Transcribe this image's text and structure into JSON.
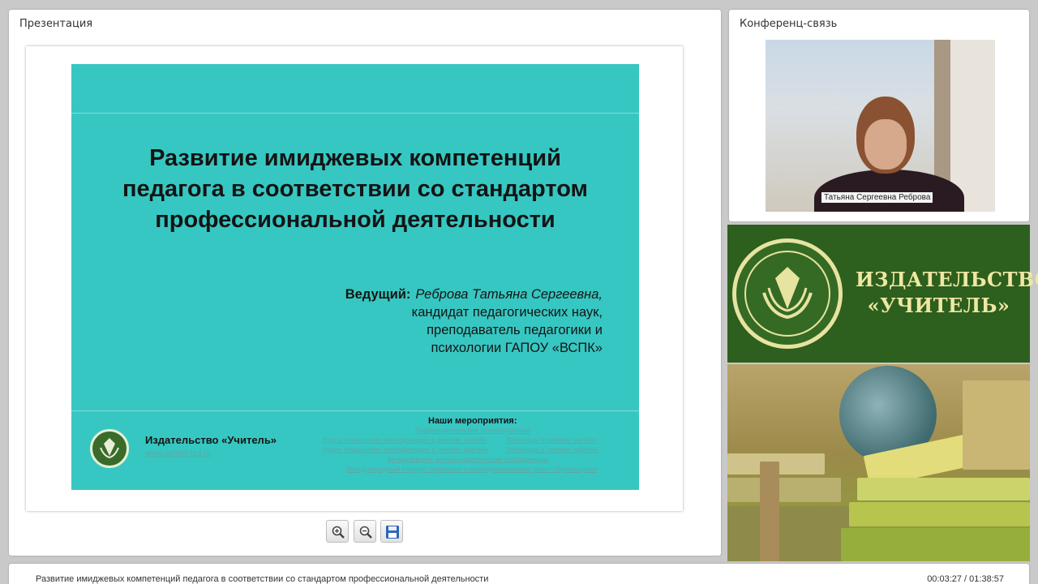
{
  "presentation": {
    "panel_title": "Презентация",
    "slide": {
      "title_lines": [
        "Развитие имиджевых компетенций",
        "педагога в соответствии со стандартом",
        "профессиональной деятельности"
      ],
      "presenter_label": "Ведущий:",
      "presenter_name": "Реброва Татьяна Сергеевна,",
      "presenter_details": [
        "кандидат педагогических наук,",
        "преподаватель педагогики и",
        "психологии ГАПОУ «ВСПК»"
      ],
      "publisher_name": "Издательство «Учитель»",
      "publisher_url": "www.uchitel-izd.ru",
      "events_title": "Наши мероприятия:",
      "events": [
        "Профессиональная переподготовка",
        "Курсы повышения квалификации в режиме онлайн",
        "Вебинары в режиме онлайн",
        "Курсы повышения квалификации в режиме офлайн",
        "Вебинары в режиме офлайн",
        "Межвузовские научно-практические конференции",
        "Международный конкурс проектных и исследовательских работ обучающихся"
      ]
    },
    "toolbar": {
      "zoom_in_icon": "zoom-in-icon",
      "zoom_out_icon": "zoom-out-icon",
      "save_icon": "save-icon"
    }
  },
  "conference": {
    "panel_title": "Конференц-связь",
    "participant_name": "Татьяна Сергеевна Реброва"
  },
  "brand": {
    "line1": "ИЗДАТЕЛЬСТВО",
    "line2": "«УЧИТЕЛЬ»",
    "colors": {
      "banner": "#2d5f1e",
      "text": "#efe7a2"
    }
  },
  "status": {
    "title": "Развитие имиджевых компетенций педагога в соответствии со стандартом профессиональной деятельности",
    "time": "00:03:27 / 01:38:57"
  },
  "colors": {
    "slide_bg": "#37c7c2",
    "link": "#5aa8a4"
  }
}
